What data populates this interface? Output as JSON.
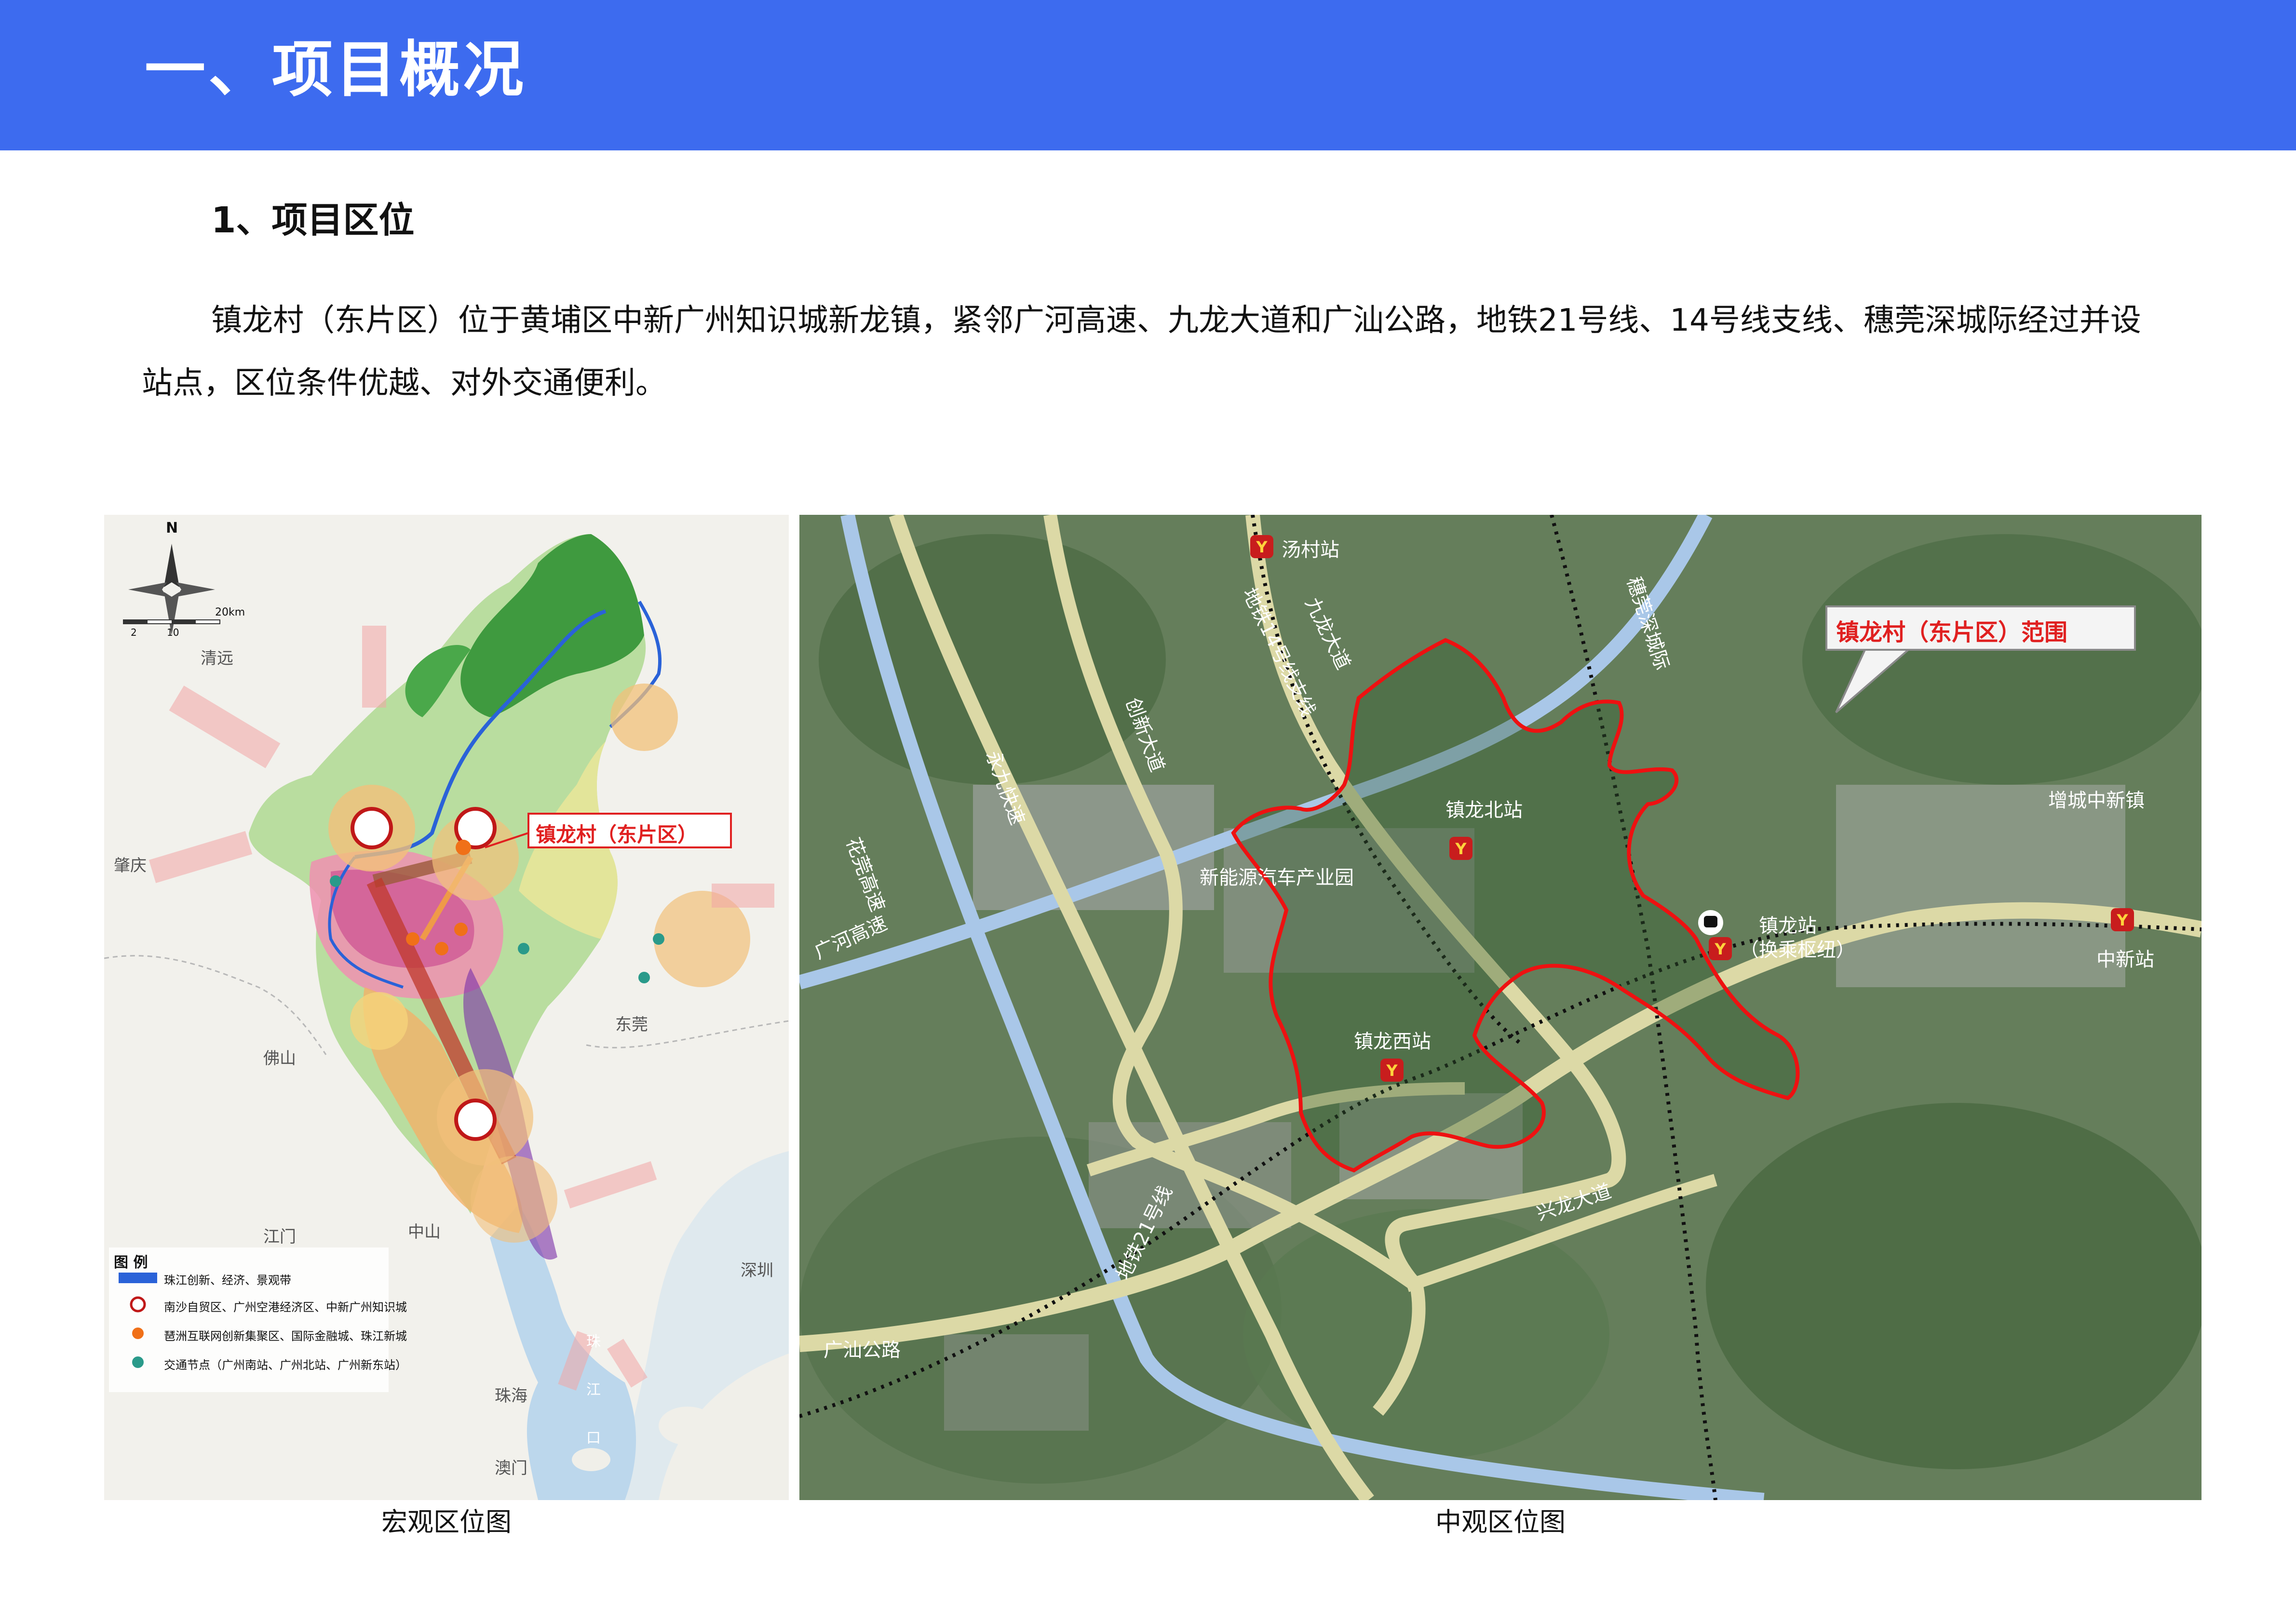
{
  "header": {
    "title": "一、项目概况",
    "accent": "#3d6bef"
  },
  "section": {
    "heading": "1、项目区位",
    "paragraph": "镇龙村（东片区）位于黄埔区中新广州知识城新龙镇，紧邻广河高速、九龙大道和广汕公路，地铁21号线、14号线支线、穗莞深城际经过并设站点，区位条件优越、对外交通便利。"
  },
  "macro_map": {
    "caption": "宏观区位图",
    "north": "N",
    "scale_label": "20km",
    "scale_ticks": [
      "2",
      "10"
    ],
    "callout": "镇龙村（东片区）",
    "city_labels": [
      "清远",
      "肇庆",
      "佛山",
      "东莞",
      "江门",
      "中山",
      "深圳",
      "珠海",
      "澳门"
    ],
    "sea_labels": [
      "珠",
      "江",
      "口"
    ],
    "legend_title": "图 例",
    "legend_items": [
      {
        "icon": "river-band-icon",
        "label": "珠江创新、经济、景观带"
      },
      {
        "icon": "core-zone-icon",
        "label": "南沙自贸区、广州空港经济区、中新广州知识城"
      },
      {
        "icon": "cluster-icon",
        "label": "琶洲互联网创新集聚区、国际金融城、珠江新城"
      },
      {
        "icon": "transit-node-icon",
        "label": "交通节点（广州南站、广州北站、广州新东站）"
      }
    ],
    "colors": {
      "callout_red": "#e02020",
      "mountain_green": "#3f9a3f",
      "river_blue": "#2a62d8"
    }
  },
  "meso_map": {
    "caption": "中观区位图",
    "callout": "镇龙村（东片区）范围",
    "stations": [
      "汤村站",
      "镇龙北站",
      "镇龙站",
      "（换乘枢纽）",
      "镇龙西站",
      "中新站"
    ],
    "roads": [
      "广河高速",
      "花莞高速",
      "永九快速",
      "创新大道",
      "地铁14号线支线",
      "九龙大道",
      "穗莞深城际",
      "地铁21号线",
      "兴龙大道",
      "广汕公路"
    ],
    "areas": [
      "新能源汽车产业园",
      "增城中新镇"
    ],
    "colors": {
      "boundary_red": "#ee1111",
      "road_fill": "#dcd9a6",
      "highway_blue": "#a9c7e8"
    }
  }
}
